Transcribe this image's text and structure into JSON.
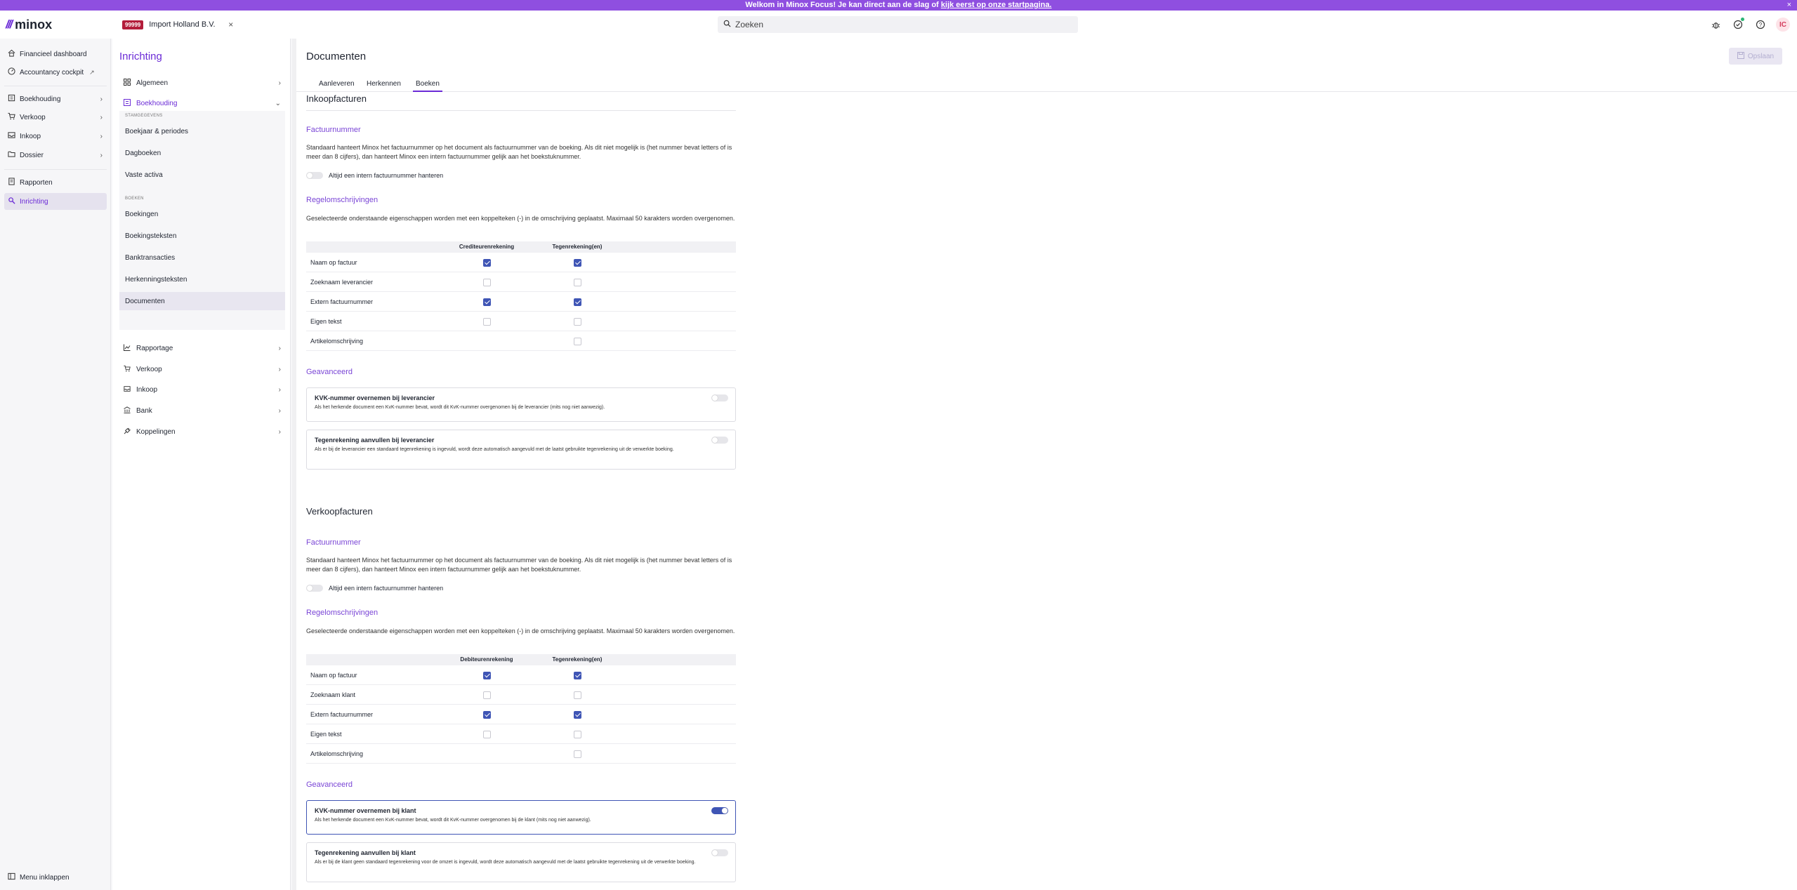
{
  "banner": {
    "text": "Welkom in Minox Focus! Je kan direct aan de slag of",
    "link": "kijk eerst op onze startpagina.",
    "close": "×"
  },
  "topbar": {
    "logo_mark": "///",
    "logo_word": "minox",
    "company_badge": "99999",
    "company_name": "Import Holland B.V.",
    "company_close": "×",
    "search_placeholder": "Zoeken",
    "avatar": "IC"
  },
  "leftnav": {
    "items": [
      {
        "label": "Financieel dashboard"
      },
      {
        "label": "Accountancy cockpit"
      },
      {
        "label": "Boekhouding"
      },
      {
        "label": "Verkoop"
      },
      {
        "label": "Inkoop"
      },
      {
        "label": "Dossier"
      },
      {
        "label": "Rapporten"
      },
      {
        "label": "Inrichting"
      }
    ],
    "collapse_label": "Menu inklappen"
  },
  "subnav": {
    "title": "Inrichting",
    "top_items": [
      {
        "label": "Algemeen"
      },
      {
        "label": "Boekhouding"
      }
    ],
    "group_label_1": "STAMGEGEVENS",
    "group1": [
      {
        "label": "Boekjaar & periodes"
      },
      {
        "label": "Dagboeken"
      },
      {
        "label": "Vaste activa"
      }
    ],
    "group_label_2": "BOEKEN",
    "group2": [
      {
        "label": "Boekingen"
      },
      {
        "label": "Boekingsteksten"
      },
      {
        "label": "Banktransacties"
      },
      {
        "label": "Herkenningsteksten"
      },
      {
        "label": "Documenten"
      }
    ],
    "bottom_items": [
      {
        "label": "Rapportage"
      },
      {
        "label": "Verkoop"
      },
      {
        "label": "Inkoop"
      },
      {
        "label": "Bank"
      },
      {
        "label": "Koppelingen"
      }
    ]
  },
  "main": {
    "title": "Documenten",
    "save_label": "Opslaan",
    "tabs": [
      {
        "label": "Aanleveren"
      },
      {
        "label": "Herkennen"
      },
      {
        "label": "Boeken"
      }
    ],
    "purchase": {
      "heading": "Inkoopfacturen",
      "invoice_heading": "Factuurnummer",
      "invoice_text": "Standaard hanteert Minox het factuurnummer op het document als factuurnummer van de boeking. Als dit niet mogelijk is (het nummer bevat letters of is meer dan 8 cijfers), dan hanteert Minox een intern factuurnummer gelijk aan het boekstuknummer.",
      "toggle_label": "Altijd een intern factuurnummer hanteren",
      "lines_heading": "Regelomschrijvingen",
      "lines_text": "Geselecteerde onderstaande eigenschappen worden met een koppelteken (-) in de omschrijving geplaatst. Maximaal 50 karakters worden overgenomen.",
      "col1": "Crediteurenrekening",
      "col2": "Tegenrekening(en)",
      "rows": [
        {
          "label": "Naam op factuur",
          "c1": true,
          "c2": true
        },
        {
          "label": "Zoeknaam leverancier",
          "c1": false,
          "c2": false
        },
        {
          "label": "Extern factuurnummer",
          "c1": true,
          "c2": true
        },
        {
          "label": "Eigen tekst",
          "c1": false,
          "c2": false
        },
        {
          "label": "Artikelomschrijving",
          "c1": null,
          "c2": false
        }
      ],
      "advanced_heading": "Geavanceerd",
      "card1_title": "KVK-nummer overnemen bij leverancier",
      "card1_desc": "Als het herkende document een KvK-nummer bevat, wordt dit KvK-nummer overgenomen bij de leverancier (mits nog niet aanwezig).",
      "card2_title": "Tegenrekening aanvullen bij leverancier",
      "card2_desc": "Als er bij de leverancier een standaard tegenrekening is ingevuld, wordt deze automatisch aangevuld met de laatst gebruikte tegenrekening uit de verwerkte boeking."
    },
    "sales": {
      "heading": "Verkoopfacturen",
      "invoice_heading": "Factuurnummer",
      "invoice_text": "Standaard hanteert Minox het factuurnummer op het document als factuurnummer van de boeking. Als dit niet mogelijk is (het nummer bevat letters of is meer dan 8 cijfers), dan hanteert Minox een intern factuurnummer gelijk aan het boekstuknummer.",
      "toggle_label": "Altijd een intern factuurnummer hanteren",
      "lines_heading": "Regelomschrijvingen",
      "lines_text": "Geselecteerde onderstaande eigenschappen worden met een koppelteken (-) in de omschrijving geplaatst. Maximaal 50 karakters worden overgenomen.",
      "col1": "Debiteurenrekening",
      "col2": "Tegenrekening(en)",
      "rows": [
        {
          "label": "Naam op factuur",
          "c1": true,
          "c2": true
        },
        {
          "label": "Zoeknaam klant",
          "c1": false,
          "c2": false
        },
        {
          "label": "Extern factuurnummer",
          "c1": true,
          "c2": true
        },
        {
          "label": "Eigen tekst",
          "c1": false,
          "c2": false
        },
        {
          "label": "Artikelomschrijving",
          "c1": null,
          "c2": false
        }
      ],
      "advanced_heading": "Geavanceerd",
      "card1_title": "KVK-nummer overnemen bij klant",
      "card1_desc": "Als het herkende document een KvK-nummer bevat, wordt dit KvK-nummer overgenomen bij de klant (mits nog niet aanwezig).",
      "card2_title": "Tegenrekening aanvullen bij klant",
      "card2_desc": "Als er bij de klant geen standaard tegenrekening voor de omzet is ingevuld, wordt deze automatisch aangevuld met de laatst gebruikte tegenrekening uit de verwerkte boeking."
    }
  }
}
